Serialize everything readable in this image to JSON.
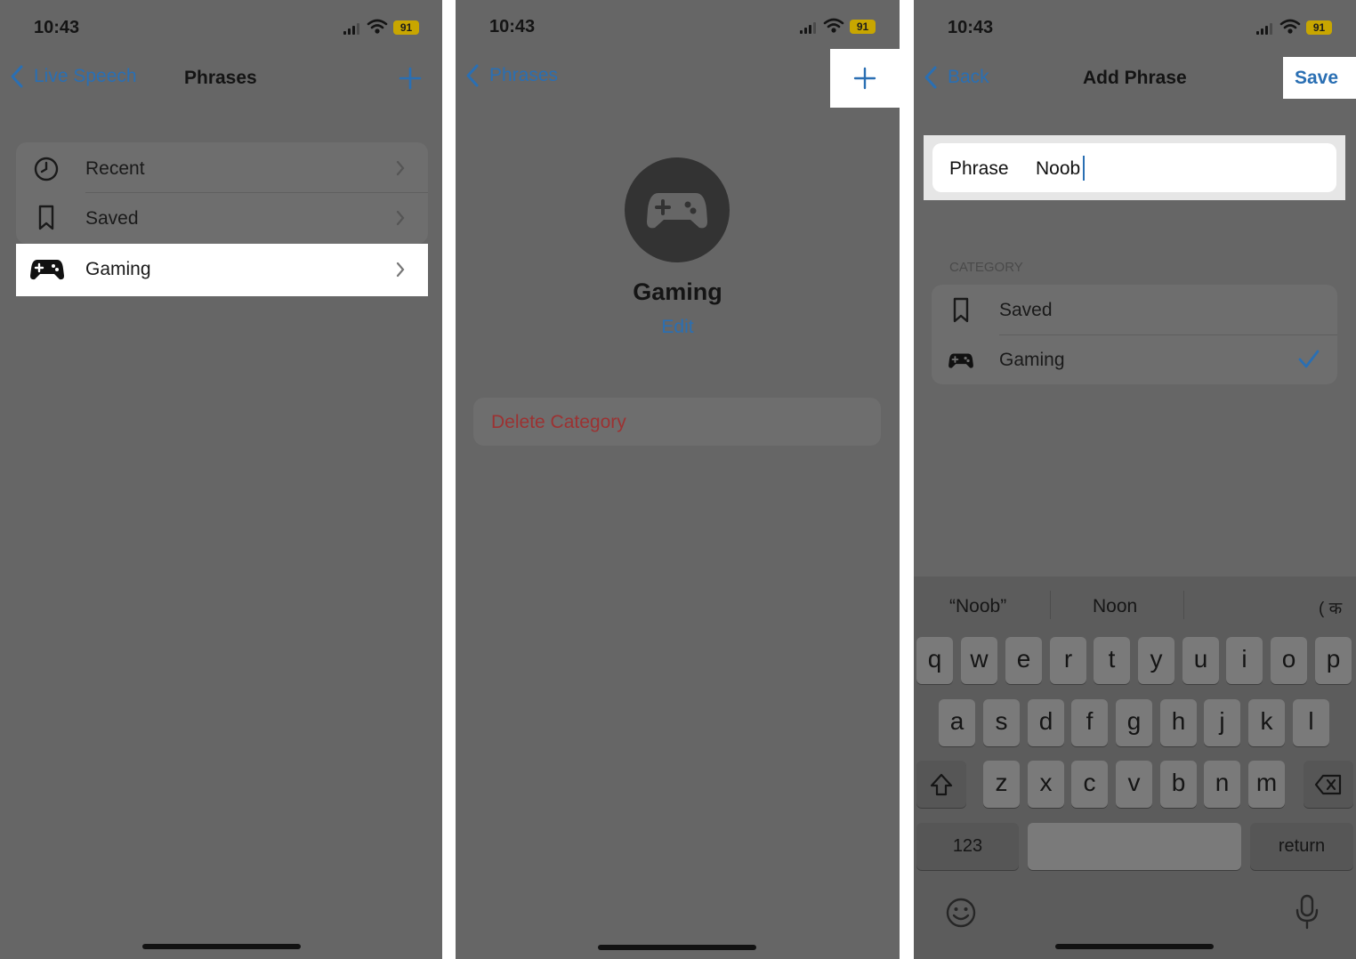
{
  "status": {
    "time": "10:43",
    "battery": "91"
  },
  "screen1": {
    "back_label": "Live Speech",
    "title": "Phrases",
    "items": [
      {
        "label": "Recent",
        "icon": "clock-icon"
      },
      {
        "label": "Saved",
        "icon": "bookmark-icon"
      },
      {
        "label": "Gaming",
        "icon": "gamecontroller-icon"
      }
    ]
  },
  "screen2": {
    "back_label": "Phrases",
    "category_name": "Gaming",
    "edit_label": "Edit",
    "delete_label": "Delete Category"
  },
  "screen3": {
    "back_label": "Back",
    "title": "Add Phrase",
    "save_label": "Save",
    "phrase_label": "Phrase",
    "phrase_value": "Noob",
    "section_header": "CATEGORY",
    "categories": [
      {
        "label": "Saved",
        "icon": "bookmark-icon",
        "selected": false
      },
      {
        "label": "Gaming",
        "icon": "gamecontroller-icon",
        "selected": true
      }
    ],
    "suggestions": [
      "“Noob”",
      "Noon",
      "( क"
    ],
    "keyboard": {
      "row1": [
        "q",
        "w",
        "e",
        "r",
        "t",
        "y",
        "u",
        "i",
        "o",
        "p"
      ],
      "row2": [
        "a",
        "s",
        "d",
        "f",
        "g",
        "h",
        "j",
        "k",
        "l"
      ],
      "row3": [
        "z",
        "x",
        "c",
        "v",
        "b",
        "n",
        "m"
      ],
      "numbers_label": "123",
      "return_label": "return"
    }
  },
  "colors": {
    "accent": "#2a6fb3",
    "destructive": "#9c3232",
    "highlight": "#ffffff",
    "dim": "#666666"
  }
}
